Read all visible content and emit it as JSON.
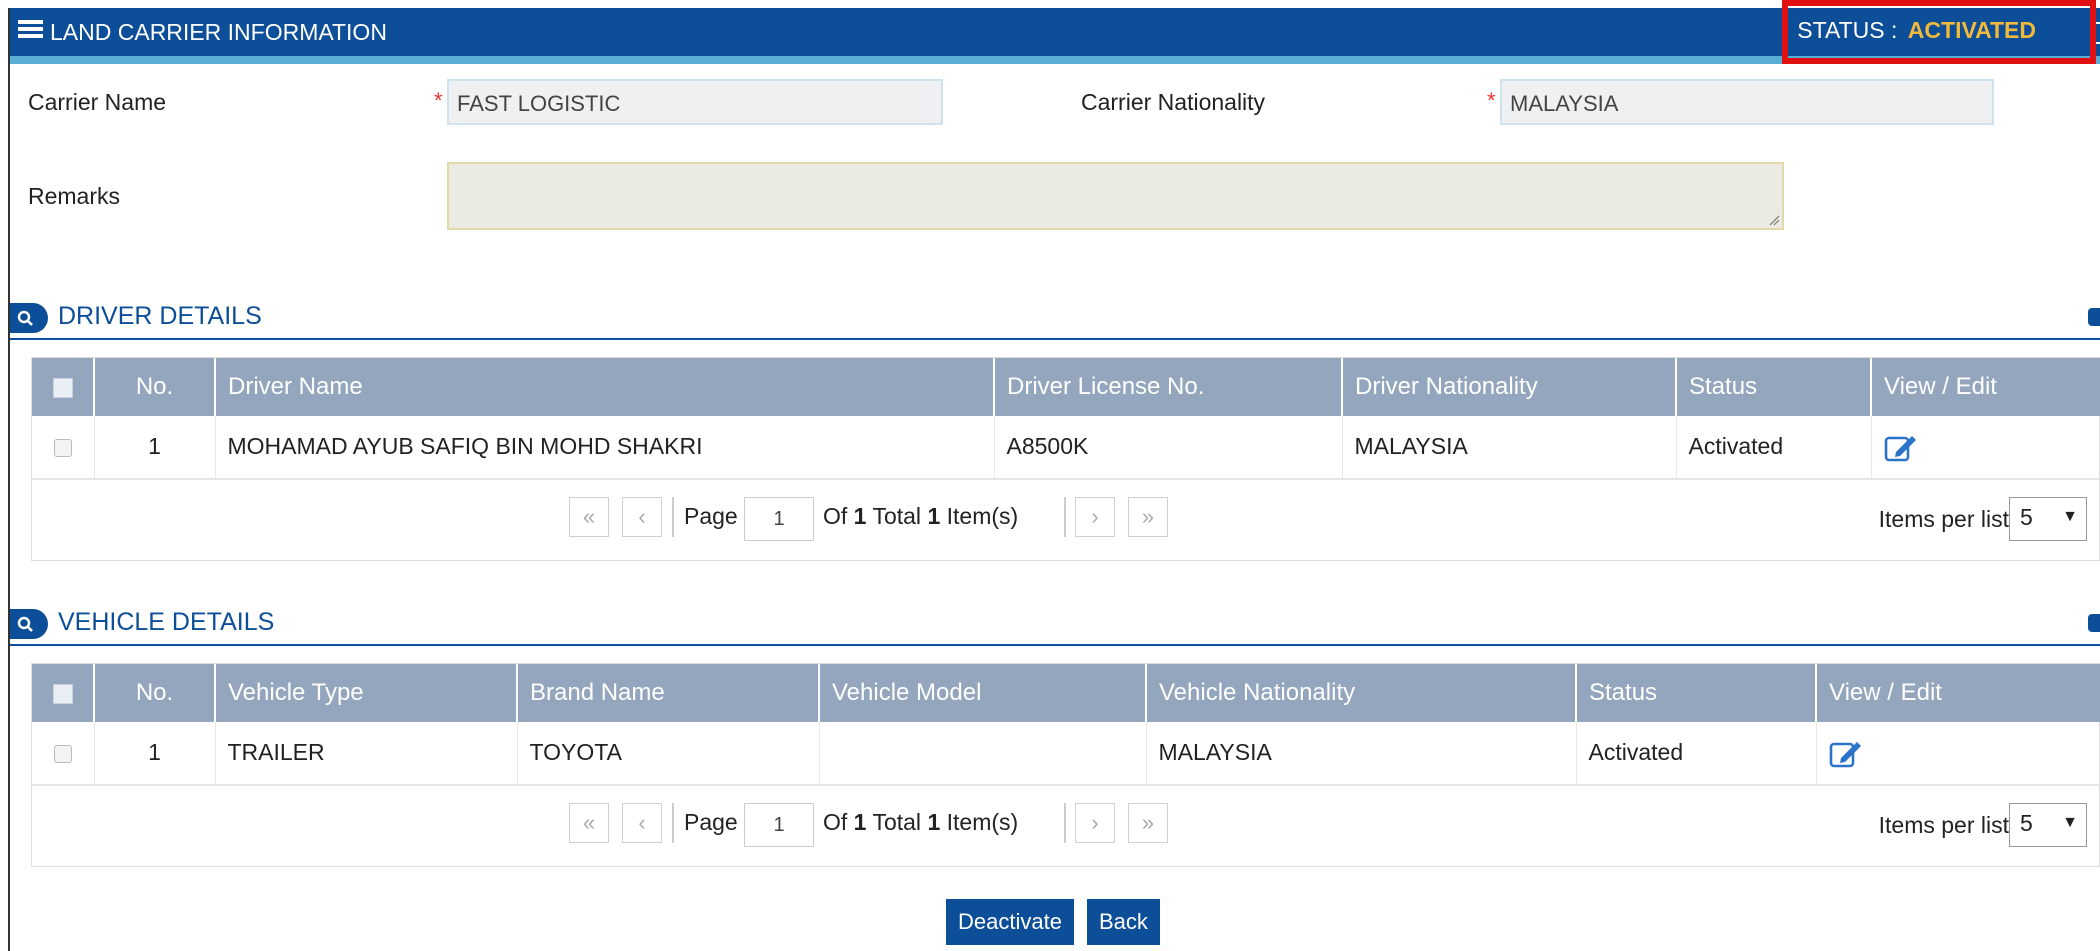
{
  "header": {
    "title": "LAND CARRIER INFORMATION",
    "status_label": "STATUS :",
    "status_value": "ACTIVATED"
  },
  "form": {
    "carrier_name_label": "Carrier Name",
    "carrier_name_value": "FAST LOGISTIC",
    "carrier_nationality_label": "Carrier Nationality",
    "carrier_nationality_value": "MALAYSIA",
    "remarks_label": "Remarks",
    "remarks_value": "",
    "required_mark": "*"
  },
  "driver_section": {
    "title": "DRIVER DETAILS",
    "columns": [
      "No.",
      "Driver Name",
      "Driver License No.",
      "Driver Nationality",
      "Status",
      "View / Edit"
    ],
    "rows": [
      {
        "no": "1",
        "name": "MOHAMAD AYUB SAFIQ BIN MOHD SHAKRI",
        "license": "A8500K",
        "nationality": "MALAYSIA",
        "status": "Activated"
      }
    ],
    "pager": {
      "page_label": "Page",
      "page": "1",
      "of_label": "Of",
      "pages": "1",
      "total_label": "Total",
      "total": "1",
      "items_label": "Item(s)",
      "per_list_label": "Items per list",
      "per_list_value": "5"
    }
  },
  "vehicle_section": {
    "title": "VEHICLE DETAILS",
    "columns": [
      "No.",
      "Vehicle Type",
      "Brand Name",
      "Vehicle Model",
      "Vehicle Nationality",
      "Status",
      "View / Edit"
    ],
    "rows": [
      {
        "no": "1",
        "type": "TRAILER",
        "brand": "TOYOTA",
        "model": "",
        "nationality": "MALAYSIA",
        "status": "Activated"
      }
    ],
    "pager": {
      "page_label": "Page",
      "page": "1",
      "of_label": "Of",
      "pages": "1",
      "total_label": "Total",
      "total": "1",
      "items_label": "Item(s)",
      "per_list_label": "Items per list",
      "per_list_value": "5"
    }
  },
  "actions": {
    "deactivate_label": "Deactivate",
    "back_label": "Back"
  },
  "pager_glyphs": {
    "first": "«",
    "prev": "‹",
    "next": "›",
    "last": "»",
    "dropdown": "▼"
  },
  "colors": {
    "header_bg": "#0d4e98",
    "status_accent": "#f2b93a",
    "highlight_box": "#e01010",
    "table_header": "#93a6be"
  }
}
